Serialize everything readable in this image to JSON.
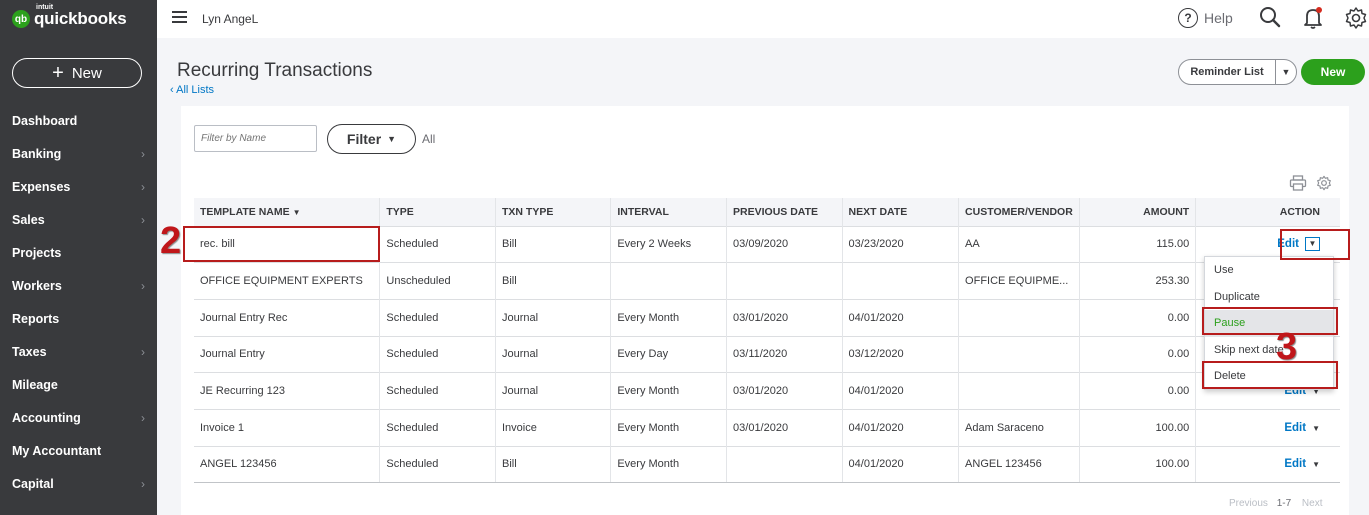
{
  "brand": {
    "logo_text": "qb",
    "intuit": "intuit",
    "name": "quickbooks"
  },
  "sidebar": {
    "new_label": "New",
    "items": [
      {
        "label": "Dashboard",
        "chevron": false
      },
      {
        "label": "Banking",
        "chevron": true
      },
      {
        "label": "Expenses",
        "chevron": true
      },
      {
        "label": "Sales",
        "chevron": true
      },
      {
        "label": "Projects",
        "chevron": false
      },
      {
        "label": "Workers",
        "chevron": true
      },
      {
        "label": "Reports",
        "chevron": false
      },
      {
        "label": "Taxes",
        "chevron": true
      },
      {
        "label": "Mileage",
        "chevron": false
      },
      {
        "label": "Accounting",
        "chevron": true
      },
      {
        "label": "My Accountant",
        "chevron": false
      },
      {
        "label": "Capital",
        "chevron": true
      }
    ]
  },
  "topbar": {
    "company": "Lyn AngeL",
    "help_label": "Help"
  },
  "page": {
    "title": "Recurring Transactions",
    "back_link": "All Lists",
    "reminder_list_label": "Reminder List",
    "new_label": "New"
  },
  "filters": {
    "placeholder": "Filter by Name",
    "filter_label": "Filter",
    "current": "All"
  },
  "table": {
    "columns": [
      "TEMPLATE NAME",
      "TYPE",
      "TXN TYPE",
      "INTERVAL",
      "PREVIOUS DATE",
      "NEXT DATE",
      "CUSTOMER/VENDOR",
      "AMOUNT",
      "ACTION"
    ],
    "rows": [
      {
        "name": "rec. bill",
        "type": "Scheduled",
        "txn": "Bill",
        "interval": "Every 2 Weeks",
        "prev": "03/09/2020",
        "next": "03/23/2020",
        "customer": "AA",
        "amount": "115.00",
        "action": "Edit"
      },
      {
        "name": "OFFICE EQUIPMENT EXPERTS",
        "type": "Unscheduled",
        "txn": "Bill",
        "interval": "",
        "prev": "",
        "next": "",
        "customer": "OFFICE EQUIPME...",
        "amount": "253.30",
        "action": "Edit"
      },
      {
        "name": "Journal Entry Rec",
        "type": "Scheduled",
        "txn": "Journal",
        "interval": "Every Month",
        "prev": "03/01/2020",
        "next": "04/01/2020",
        "customer": "",
        "amount": "0.00",
        "action": "Edit"
      },
      {
        "name": "Journal Entry",
        "type": "Scheduled",
        "txn": "Journal",
        "interval": "Every Day",
        "prev": "03/11/2020",
        "next": "03/12/2020",
        "customer": "",
        "amount": "0.00",
        "action": "Edit"
      },
      {
        "name": "JE Recurring 123",
        "type": "Scheduled",
        "txn": "Journal",
        "interval": "Every Month",
        "prev": "03/01/2020",
        "next": "04/01/2020",
        "customer": "",
        "amount": "0.00",
        "action": "Edit"
      },
      {
        "name": "Invoice 1",
        "type": "Scheduled",
        "txn": "Invoice",
        "interval": "Every Month",
        "prev": "03/01/2020",
        "next": "04/01/2020",
        "customer": "Adam Saraceno",
        "amount": "100.00",
        "action": "Edit"
      },
      {
        "name": "ANGEL 123456",
        "type": "Scheduled",
        "txn": "Bill",
        "interval": "Every Month",
        "prev": "",
        "next": "04/01/2020",
        "customer": "ANGEL 123456",
        "amount": "100.00",
        "action": "Edit"
      }
    ]
  },
  "action_menu": {
    "items": [
      "Use",
      "Duplicate",
      "Pause",
      "Skip next date",
      "Delete"
    ],
    "highlighted": "Pause"
  },
  "pagination": {
    "previous": "Previous",
    "range": "1-7",
    "next": "Next"
  },
  "annotations": {
    "step_2": "2",
    "step_3": "3"
  },
  "colors": {
    "sidebar": "#393a3d",
    "accent_green": "#2ca01c",
    "link_blue": "#0077c5",
    "annotation_red": "#b71c1c"
  }
}
